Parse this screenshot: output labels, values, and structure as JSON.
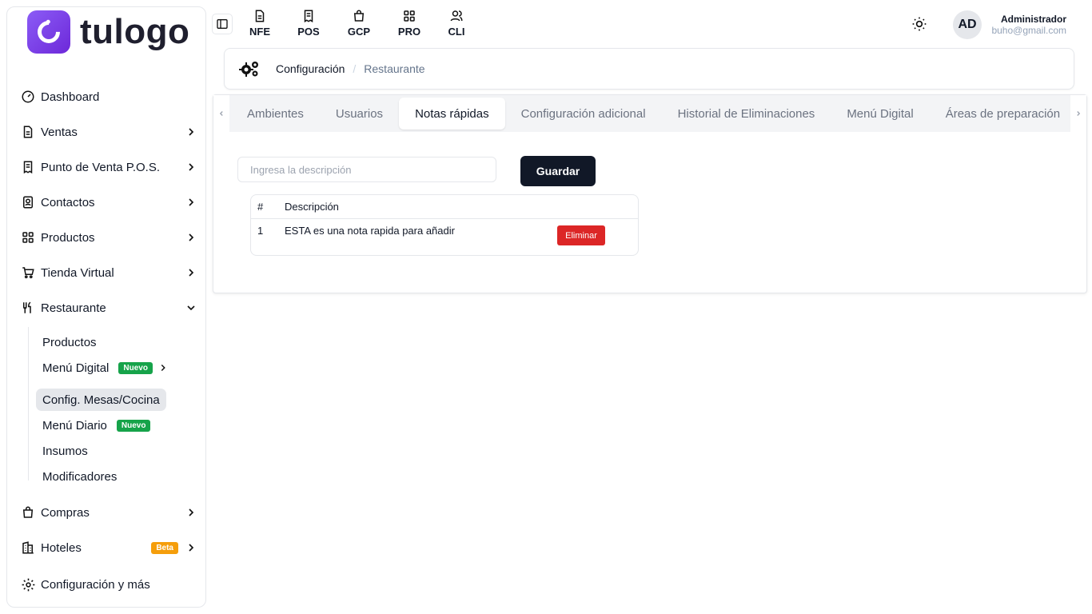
{
  "brand": {
    "name": "tulogo",
    "accent": "#7c3aed"
  },
  "sidebar": {
    "items": [
      {
        "label": "Dashboard",
        "icon": "gauge-icon"
      },
      {
        "label": "Ventas",
        "icon": "document-icon"
      },
      {
        "label": "Punto de Venta P.O.S.",
        "icon": "receipt-icon"
      },
      {
        "label": "Contactos",
        "icon": "contacts-icon"
      },
      {
        "label": "Productos",
        "icon": "grid-icon"
      },
      {
        "label": "Tienda Virtual",
        "icon": "cart-icon"
      },
      {
        "label": "Restaurante",
        "icon": "utensils-icon"
      }
    ],
    "restaurant_sub": [
      {
        "label": "Productos"
      },
      {
        "label": "Menú Digital",
        "badge": "Nuevo"
      },
      {
        "label": "Config. Mesas/Cocina"
      },
      {
        "label": "Menú Diario",
        "badge": "Nuevo"
      },
      {
        "label": "Insumos"
      },
      {
        "label": "Modificadores"
      }
    ],
    "bottom_items": [
      {
        "label": "Compras",
        "icon": "bag-icon"
      },
      {
        "label": "Hoteles",
        "icon": "building-icon",
        "badge": "Beta"
      },
      {
        "label": "Configuración y más",
        "icon": "gear-icon"
      }
    ]
  },
  "topbar": {
    "quick_links": [
      {
        "label": "NFE",
        "icon": "document-icon"
      },
      {
        "label": "POS",
        "icon": "receipt-icon"
      },
      {
        "label": "GCP",
        "icon": "bag-icon"
      },
      {
        "label": "PRO",
        "icon": "grid-icon"
      },
      {
        "label": "CLI",
        "icon": "users-icon"
      }
    ],
    "user": {
      "initials": "AD",
      "name": "Administrador",
      "email": "buho@gmail.com"
    }
  },
  "breadcrumb": {
    "section": "Configuración",
    "current": "Restaurante"
  },
  "tabs": [
    {
      "label": "Ambientes"
    },
    {
      "label": "Usuarios"
    },
    {
      "label": "Notas rápidas",
      "active": true
    },
    {
      "label": "Configuración adicional"
    },
    {
      "label": "Historial de Eliminaciones"
    },
    {
      "label": "Menú Digital"
    },
    {
      "label": "Áreas de preparación"
    }
  ],
  "form": {
    "placeholder": "Ingresa la descripción",
    "value": "",
    "save_label": "Guardar"
  },
  "table": {
    "headers": [
      "#",
      "Descripción"
    ],
    "rows": [
      {
        "index": "1",
        "description": "ESTA es una nota rapida para añadir",
        "action": "Eliminar"
      }
    ]
  }
}
